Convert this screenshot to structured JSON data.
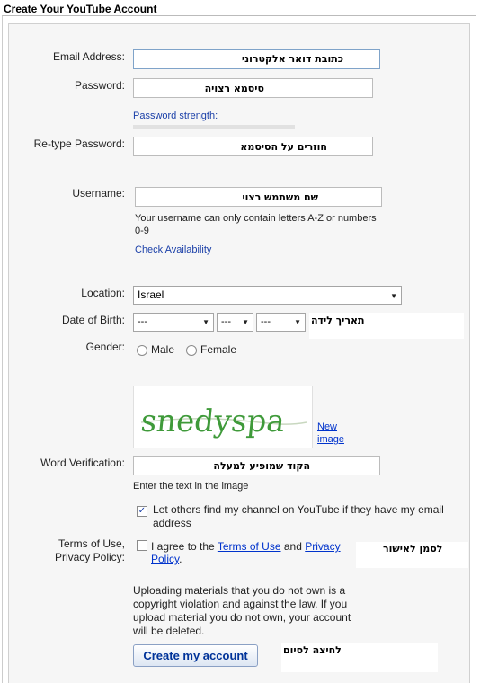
{
  "page": {
    "title": "Create Your YouTube Account"
  },
  "email": {
    "label": "Email Address:",
    "value": "כתובת דואר אלקטרוני"
  },
  "password": {
    "label": "Password:",
    "value": "סיסמא רצויה",
    "strength_label": "Password strength:"
  },
  "retype": {
    "label": "Re-type Password:",
    "value": "חוזרים על הסיסמא"
  },
  "username": {
    "label": "Username:",
    "value": "שם משתמש רצוי",
    "hint_line1": "Your username can only contain letters A-Z or numbers",
    "hint_line2": "0-9",
    "check_link": "Check Availability"
  },
  "location": {
    "label": "Location:",
    "selected": "Israel"
  },
  "dob": {
    "label": "Date of Birth:",
    "month": "---",
    "day": "---",
    "year": "---",
    "note": "תאריך לידה"
  },
  "gender": {
    "label": "Gender:",
    "male": "Male",
    "female": "Female"
  },
  "captcha": {
    "text": "snedyspa",
    "new_image_line1": "New",
    "new_image_line2": "image"
  },
  "verification": {
    "label": "Word Verification:",
    "value": "הקוד שמופיע למעלה",
    "hint": "Enter the text in the image"
  },
  "share": {
    "checked": true,
    "text_line1": "Let others find my channel on YouTube if they have my email",
    "text_line2": "address"
  },
  "terms": {
    "label_line1": "Terms of Use,",
    "label_line2": "Privacy Policy:",
    "prefix": "I agree to the",
    "terms_link": "Terms of Use",
    "and": "and",
    "privacy_link_1": "Privacy",
    "privacy_link_2": "Policy",
    "period": ".",
    "note": "לסמן לאישור"
  },
  "upload_warning": {
    "line1": "Uploading materials that you do not own is a",
    "line2": "copyright violation and against the law. If you",
    "line3": "upload material you do not own, your account",
    "line4": "will be deleted."
  },
  "submit": {
    "label": "Create my account",
    "note": "לחיצה לסיום"
  },
  "colors": {
    "link": "#0033cc",
    "panel_bg": "#f6f6f6",
    "button_text": "#003399"
  }
}
